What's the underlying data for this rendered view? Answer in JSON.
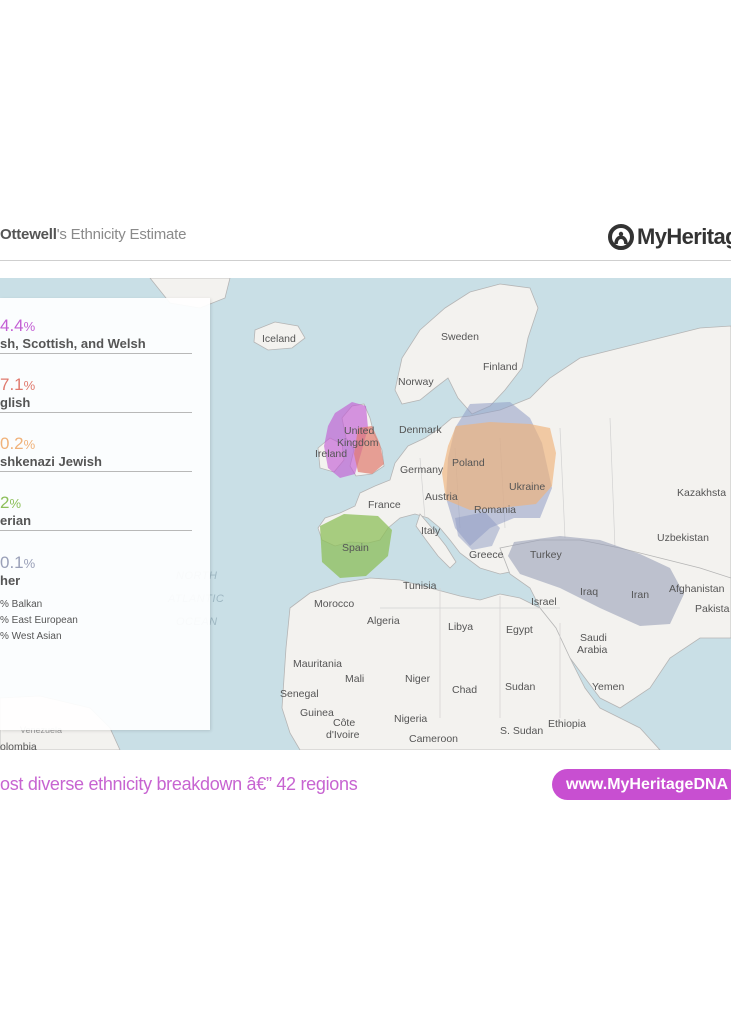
{
  "header": {
    "name": "Ottewell",
    "title_suffix": "'s Ethnicity Estimate",
    "logo_text": "MyHeritage"
  },
  "ethnicities": [
    {
      "percent": "4.4",
      "name": "sh, Scottish, and Welsh",
      "color": "#c35ed4"
    },
    {
      "percent": "7.1",
      "name": "glish",
      "color": "#e07a6e"
    },
    {
      "percent": "0.2",
      "name": "shkenazi Jewish",
      "color": "#f0b27a"
    },
    {
      "percent": "2",
      "name": "erian",
      "color": "#8dbf5a"
    },
    {
      "percent": "0.1",
      "name": "her",
      "color": "#9aa0b8"
    }
  ],
  "percent_symbol": "%",
  "other_breakdown": [
    {
      "label": "% Balkan"
    },
    {
      "label": "% East European"
    },
    {
      "label": "% West Asian"
    }
  ],
  "map_labels": {
    "iceland": "Iceland",
    "sweden": "Sweden",
    "finland": "Finland",
    "norway": "Norway",
    "uk_1": "United",
    "uk_2": "Kingdom",
    "ireland": "Ireland",
    "denmark": "Denmark",
    "germany": "Germany",
    "poland": "Poland",
    "ukraine": "Ukraine",
    "austria": "Austria",
    "france": "France",
    "romania": "Romania",
    "kazakhstan": "Kazakhsta",
    "italy": "Italy",
    "uzbekistan": "Uzbekistan",
    "spain": "Spain",
    "greece": "Greece",
    "turkey": "Turkey",
    "afghanistan": "Afghanistan",
    "pakistan": "Pakista",
    "tunisia": "Tunisia",
    "morocco": "Morocco",
    "iraq": "Iraq",
    "iran": "Iran",
    "israel": "Israel",
    "algeria": "Algeria",
    "libya": "Libya",
    "egypt": "Egypt",
    "saudi_1": "Saudi",
    "saudi_2": "Arabia",
    "mauritania": "Mauritania",
    "mali": "Mali",
    "niger": "Niger",
    "chad": "Chad",
    "sudan": "Sudan",
    "yemen": "Yemen",
    "senegal": "Senegal",
    "guinea": "Guinea",
    "cote_1": "Côte",
    "cote_2": "d'Ivoire",
    "nigeria": "Nigeria",
    "ethiopia": "Ethiopia",
    "s_sudan": "S. Sudan",
    "cameroon": "Cameroon",
    "venezuela": "Venezuela",
    "colombia": "olombia",
    "ocean_1": "NORTH",
    "ocean_2": "ATLANTIC",
    "ocean_3": "OCEAN"
  },
  "footer": {
    "tagline": "ost diverse ethnicity breakdown â€” 42 regions",
    "url": "www.MyHeritageDNA"
  },
  "colors": {
    "accent": "#c84fd1",
    "sea": "#c9dfe6",
    "land": "#f3f2ef"
  }
}
